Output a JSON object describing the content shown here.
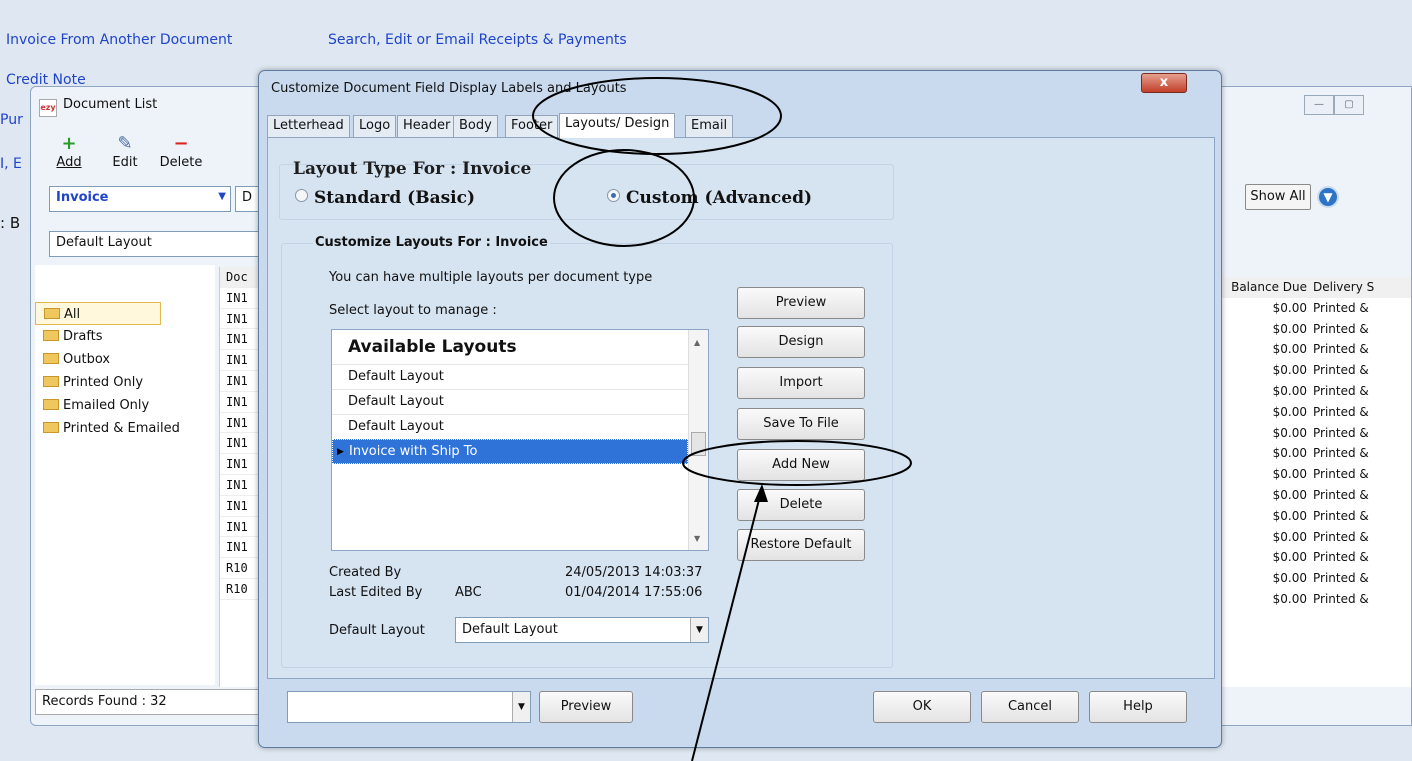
{
  "background": {
    "links": [
      "Invoice From Another Document",
      "Search, Edit or Email Receipts & Payments",
      "Credit Note",
      "Pur",
      "I, E",
      ": B"
    ]
  },
  "doclist": {
    "title": "Document List",
    "toolbar": {
      "add": "Add",
      "edit": "Edit",
      "delete": "Delete"
    },
    "doc_type": "Invoice",
    "partial_combo": "D",
    "layout": "Default Layout",
    "show_all": "Show All",
    "folders": [
      "All",
      "Drafts",
      "Outbox",
      "Printed Only",
      "Emailed Only",
      "Printed & Emailed"
    ],
    "col_header": "Doc",
    "doc_cells": [
      "IN1",
      "IN1",
      "IN1",
      "IN1",
      "IN1",
      "IN1",
      "IN1",
      "IN1",
      "IN1",
      "IN1",
      "IN1",
      "IN1",
      "IN1",
      "R10",
      "R10"
    ],
    "right_headers": {
      "balance": "Balance Due",
      "delivery": "Delivery S"
    },
    "right_rows": [
      {
        "balance": "$0.00",
        "delivery": "Printed &"
      },
      {
        "balance": "$0.00",
        "delivery": "Printed &"
      },
      {
        "balance": "$0.00",
        "delivery": "Printed &"
      },
      {
        "balance": "$0.00",
        "delivery": "Printed &"
      },
      {
        "balance": "$0.00",
        "delivery": "Printed &"
      },
      {
        "balance": "$0.00",
        "delivery": "Printed &"
      },
      {
        "balance": "$0.00",
        "delivery": "Printed &"
      },
      {
        "balance": "$0.00",
        "delivery": "Printed &"
      },
      {
        "balance": "$0.00",
        "delivery": "Printed &"
      },
      {
        "balance": "$0.00",
        "delivery": "Printed &"
      },
      {
        "balance": "$0.00",
        "delivery": "Printed &"
      },
      {
        "balance": "$0.00",
        "delivery": "Printed &"
      },
      {
        "balance": "$0.00",
        "delivery": "Printed &"
      },
      {
        "balance": "$0.00",
        "delivery": "Printed &"
      },
      {
        "balance": "$0.00",
        "delivery": "Printed &"
      }
    ],
    "records_found": "Records Found : 32"
  },
  "dialog": {
    "title": "Customize Document Field Display Labels and Layouts",
    "close": "x",
    "tabs": [
      "Letterhead",
      "Logo",
      "Header",
      "Body",
      "Footer",
      "Layouts/ Design",
      "Email"
    ],
    "active_tab": "Layouts/ Design",
    "layout_type_title": "Layout Type For : Invoice",
    "radio_standard": "Standard (Basic)",
    "radio_custom": "Custom (Advanced)",
    "customize_title": "Customize Layouts For : Invoice",
    "info_line": "You can have multiple layouts per document type",
    "select_label": "Select layout to manage :",
    "list_header": "Available Layouts",
    "layouts": [
      "Default Layout",
      "Default Layout",
      "Default Layout",
      "Invoice with Ship To"
    ],
    "selected_layout": "Invoice with Ship To",
    "buttons": {
      "preview": "Preview",
      "design": "Design",
      "import": "Import",
      "save_to_file": "Save To File",
      "add_new": "Add New",
      "delete": "Delete",
      "restore_default": "Restore Default"
    },
    "created_by_label": "Created By",
    "created_by_value": "",
    "created_date": "24/05/2013 14:03:37",
    "last_edited_label": "Last Edited By",
    "last_edited_value": "ABC",
    "last_edited_date": "01/04/2014 17:55:06",
    "default_layout_label": "Default Layout",
    "default_layout_value": "Default Layout",
    "bottom": {
      "combo_value": "",
      "preview": "Preview",
      "ok": "OK",
      "cancel": "Cancel",
      "help": "Help"
    }
  },
  "colors": {
    "link": "#1f44c8",
    "selection": "#2f73d8",
    "dialog_bg": "#c9daee",
    "close_button": "#c2402b"
  }
}
